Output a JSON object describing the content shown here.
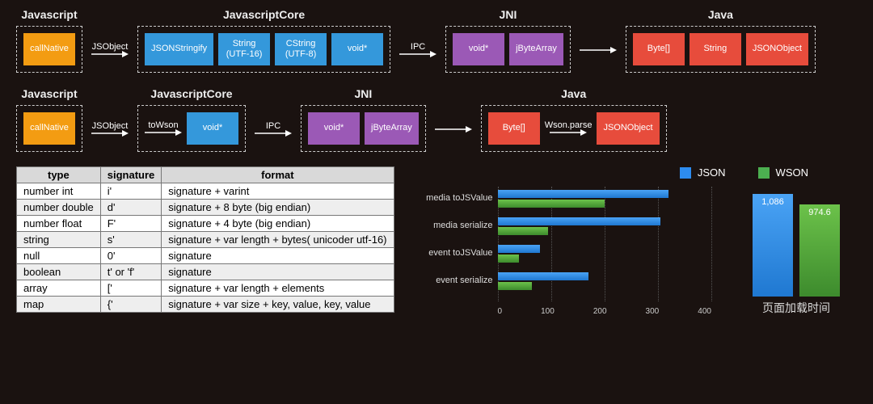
{
  "flow1": {
    "cols": [
      {
        "title": "Javascript",
        "color": "",
        "nodes": [
          {
            "text": "callNative",
            "cls": "orange"
          }
        ]
      },
      {
        "title": "JavascriptCore",
        "nodes": [
          {
            "text": "JSONStringify",
            "cls": "blue"
          },
          {
            "text": "String\n(UTF-16)",
            "cls": "blue"
          },
          {
            "text": "CString\n(UTF-8)",
            "cls": "blue"
          },
          {
            "text": "void*",
            "cls": "blue"
          }
        ]
      },
      {
        "title": "JNI",
        "nodes": [
          {
            "text": "void*",
            "cls": "purple"
          },
          {
            "text": "jByteArray",
            "cls": "purple"
          }
        ]
      },
      {
        "title": "Java",
        "nodes": [
          {
            "text": "Byte[]",
            "cls": "red"
          },
          {
            "text": "String",
            "cls": "red"
          },
          {
            "text": "JSONObject",
            "cls": "red"
          }
        ]
      }
    ],
    "arrows": [
      {
        "label": "JSObject"
      },
      {
        "label": "IPC"
      },
      {
        "label": ""
      }
    ]
  },
  "flow2": {
    "cols": [
      {
        "title": "Javascript",
        "nodes": [
          {
            "text": "callNative",
            "cls": "orange"
          }
        ]
      },
      {
        "title": "JavascriptCore",
        "inner_arrow": "toWson",
        "nodes": [
          {
            "text": "void*",
            "cls": "blue"
          }
        ]
      },
      {
        "title": "JNI",
        "nodes": [
          {
            "text": "void*",
            "cls": "purple"
          },
          {
            "text": "jByteArray",
            "cls": "purple"
          }
        ]
      },
      {
        "title": "Java",
        "inner_arrow": "Wson.parse",
        "nodes": [
          {
            "text": "Byte[]",
            "cls": "red"
          },
          {
            "text": "JSONObject",
            "cls": "red"
          }
        ]
      }
    ],
    "arrows": [
      {
        "label": "JSObject"
      },
      {
        "label": "IPC"
      },
      {
        "label": ""
      }
    ]
  },
  "table": {
    "headers": [
      "type",
      "signature",
      "format"
    ],
    "rows": [
      [
        "number int",
        "i'",
        "signature + varint"
      ],
      [
        "number double",
        "d'",
        "signature + 8 byte (big endian)"
      ],
      [
        "number float",
        "F'",
        "signature + 4 byte (big endian)"
      ],
      [
        "string",
        "s'",
        "signature + var length + bytes( unicoder utf-16)"
      ],
      [
        "null",
        "0'",
        "signature"
      ],
      [
        "boolean",
        "t' or 'f'",
        "signature"
      ],
      [
        "array",
        "['",
        "signature + var length + elements"
      ],
      [
        "map",
        "{'",
        "signature + var size + key, value, key, value"
      ]
    ]
  },
  "legend": {
    "json": "JSON",
    "wson": "WSON"
  },
  "chart_data": {
    "hbar": {
      "type": "bar",
      "orientation": "horizontal",
      "xlim": [
        0,
        400
      ],
      "xticks": [
        0,
        100,
        200,
        300,
        400
      ],
      "categories": [
        "media toJSValue",
        "media serialize",
        "event toJSValue",
        "event serialize"
      ],
      "series": [
        {
          "name": "JSON",
          "values": [
            320,
            305,
            80,
            170
          ]
        },
        {
          "name": "WSON",
          "values": [
            200,
            95,
            40,
            65
          ]
        }
      ]
    },
    "vbar": {
      "type": "bar",
      "title": "页面加载时间",
      "ylim": [
        0,
        1200
      ],
      "series": [
        {
          "name": "JSON",
          "value": 1086,
          "label": "1,086"
        },
        {
          "name": "WSON",
          "value": 974.6,
          "label": "974.6"
        }
      ]
    }
  }
}
